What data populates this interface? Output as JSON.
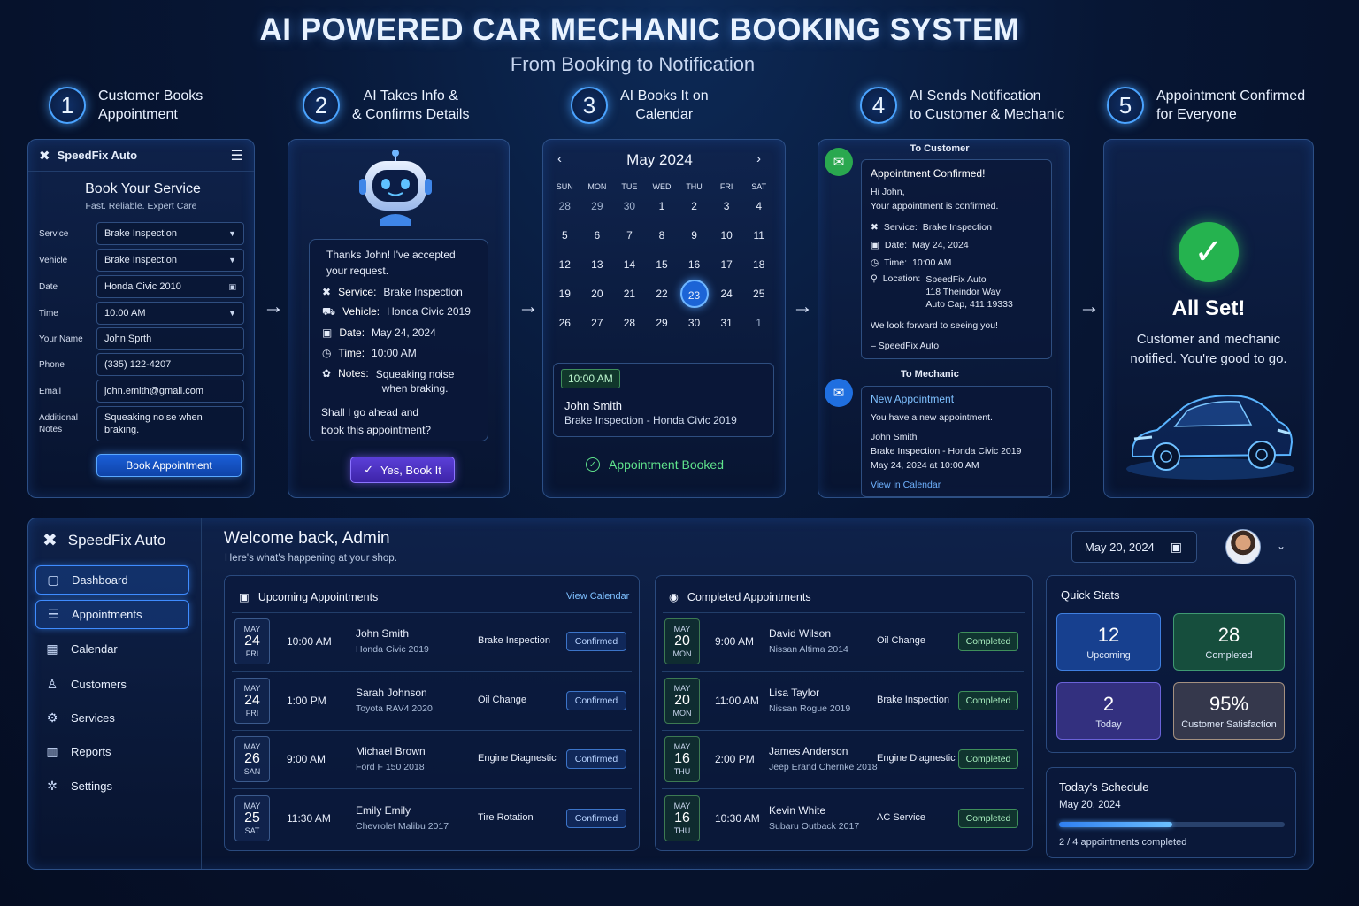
{
  "header": {
    "title": "AI POWERED CAR MECHANIC BOOKING SYSTEM",
    "subtitle": "From Booking to Notification"
  },
  "steps": [
    {
      "num": "1",
      "text": "Customer Books\nAppointment"
    },
    {
      "num": "2",
      "text": "AI Takes Info &\n& Confirms Details"
    },
    {
      "num": "3",
      "text": "AI Books It on\nCalendar"
    },
    {
      "num": "4",
      "text": "AI Sends Notification\nto Customer & Mechanic"
    },
    {
      "num": "5",
      "text": "Appointment Confirmed\nfor Everyone"
    }
  ],
  "arrow": "→",
  "form": {
    "brand": "SpeedFix Auto",
    "title": "Book Your Service",
    "tagline": "Fast. Reliable. Expert Care",
    "fields": [
      {
        "label": "Service",
        "value": "Brake Inspection",
        "kind": "select"
      },
      {
        "label": "Vehicle",
        "value": "Brake Inspection",
        "kind": "select"
      },
      {
        "label": "Date",
        "value": "Honda Civic 2010",
        "kind": "date"
      },
      {
        "label": "Time",
        "value": "10:00 AM",
        "kind": "select"
      },
      {
        "label": "Your Name",
        "value": "John Sprth",
        "kind": "text"
      },
      {
        "label": "Phone",
        "value": "(335) 122-4207",
        "kind": "text"
      },
      {
        "label": "Email",
        "value": "john.emith@gmail.com",
        "kind": "text"
      },
      {
        "label": "Additional\nNotes",
        "value": "Squeaking noise when\nbraking.",
        "kind": "textarea"
      }
    ],
    "submit": "Book Appointment"
  },
  "chat": {
    "intro": "Thanks John! I've accepted\nyour request.",
    "service_label": "Service:",
    "service": "Brake Inspection",
    "vehicle_label": "Vehicle:",
    "vehicle": "Honda Civic 2019",
    "date_label": "Date:",
    "date": "May 24, 2024",
    "time_label": "Time:",
    "time": "10:00 AM",
    "notes_label": "Notes:",
    "notes": "Squeaking noise\nwhen braking.",
    "question": "Shall I go ahead and\nbook this appointment?",
    "confirm_button": "Yes, Book It"
  },
  "calendar": {
    "month": "May 2024",
    "prev": "‹",
    "next": "›",
    "dow": [
      "SUN",
      "MON",
      "TUE",
      "WED",
      "THU",
      "FRI",
      "SAT"
    ],
    "days": [
      "28",
      "29",
      "30",
      "1",
      "2",
      "3",
      "4",
      "5",
      "6",
      "7",
      "8",
      "9",
      "10",
      "11",
      "12",
      "13",
      "14",
      "15",
      "16",
      "17",
      "18",
      "19",
      "20",
      "21",
      "22",
      "23",
      "24",
      "25",
      "26",
      "27",
      "28",
      "29",
      "30",
      "31",
      "1"
    ],
    "muted_days": [
      0,
      1,
      2,
      34
    ],
    "selected_day_index": 25,
    "slot_time": "10:00 AM",
    "slot_name": "John Smith",
    "slot_detail": "Brake Inspection - Honda Civic 2019",
    "status": "Appointment Booked"
  },
  "notify": {
    "customer_heading": "To Customer",
    "c_title": "Appointment Confirmed!",
    "c_greeting": "Hi John,",
    "c_line": "Your appointment is confirmed.",
    "c_service_label": "Service:",
    "c_service": "Brake Inspection",
    "c_date_label": "Date:",
    "c_date": "May 24, 2024",
    "c_time_label": "Time:",
    "c_time": "10:00 AM",
    "c_loc_label": "Location:",
    "c_loc": "SpeedFix Auto\n118 Theindor Way\nAuto Cap, 411 19333",
    "c_closing": "We look forward to seeing you!",
    "c_sign": "– SpeedFix Auto",
    "mechanic_heading": "To Mechanic",
    "m_title": "New Appointment",
    "m_line": "You have a new appointment.",
    "m_name": "John Smith",
    "m_detail": "Brake Inspection - Honda Civic 2019",
    "m_when": "May 24, 2024 at 10:00 AM",
    "m_link": "View in Calendar"
  },
  "done": {
    "title": "All Set!",
    "message": "Customer and mechanic\nnotified. You're good to go."
  },
  "dashboard": {
    "brand": "SpeedFix Auto",
    "nav": [
      {
        "label": "Dashboard",
        "icon": "▢",
        "active": true
      },
      {
        "label": "Appointments",
        "icon": "☰",
        "active": true
      },
      {
        "label": "Calendar",
        "icon": "▦",
        "active": false
      },
      {
        "label": "Customers",
        "icon": "♙",
        "active": false
      },
      {
        "label": "Services",
        "icon": "⚙",
        "active": false
      },
      {
        "label": "Reports",
        "icon": "▥",
        "active": false
      },
      {
        "label": "Settings",
        "icon": "✲",
        "active": false
      }
    ],
    "welcome": "Welcome back, Admin",
    "welcome_sub": "Here's what's happening at your shop.",
    "date": "May 20, 2024",
    "upcoming": {
      "title": "Upcoming Appointments",
      "link": "View Calendar",
      "rows": [
        {
          "month": "MAY",
          "day": "24",
          "wd": "FRI",
          "time": "10:00 AM",
          "name": "John Smith",
          "car": "Honda Civic 2019",
          "service": "Brake Inspection",
          "status": "Confirmed"
        },
        {
          "month": "MAY",
          "day": "24",
          "wd": "FRI",
          "time": "1:00 PM",
          "name": "Sarah Johnson",
          "car": "Toyota RAV4 2020",
          "service": "Oil Change",
          "status": "Confirmed"
        },
        {
          "month": "MAY",
          "day": "26",
          "wd": "SAN",
          "time": "9:00 AM",
          "name": "Michael Brown",
          "car": "Ford F 150 2018",
          "service": "Engine Diagnestic",
          "status": "Confirmed"
        },
        {
          "month": "MAY",
          "day": "25",
          "wd": "SAT",
          "time": "11:30 AM",
          "name": "Emily Emily",
          "car": "Chevrolet Malibu 2017",
          "service": "Tire Rotation",
          "status": "Confirmed"
        }
      ]
    },
    "completed": {
      "title": "Completed Appointments",
      "rows": [
        {
          "month": "MAY",
          "day": "20",
          "wd": "MON",
          "time": "9:00 AM",
          "name": "David Wilson",
          "car": "Nissan Altima 2014",
          "service": "Oil Change",
          "status": "Completed"
        },
        {
          "month": "MAY",
          "day": "20",
          "wd": "MON",
          "time": "11:00 AM",
          "name": "Lisa Taylor",
          "car": "Nissan Rogue 2019",
          "service": "Brake Inspection",
          "status": "Completed"
        },
        {
          "month": "MAY",
          "day": "16",
          "wd": "THU",
          "time": "2:00 PM",
          "name": "James Anderson",
          "car": "Jeep Erand Chernke 2018",
          "service": "Engine Diagnestic",
          "status": "Completed"
        },
        {
          "month": "MAY",
          "day": "16",
          "wd": "THU",
          "time": "10:30 AM",
          "name": "Kevin White",
          "car": "Subaru Outback 2017",
          "service": "AC Service",
          "status": "Completed"
        }
      ]
    },
    "quick_stats": {
      "title": "Quick Stats",
      "items": [
        {
          "value": "12",
          "label": "Upcoming",
          "color": "#1a4aa8"
        },
        {
          "value": "28",
          "label": "Completed",
          "color": "#1b5a45"
        },
        {
          "value": "2",
          "label": "Today",
          "color": "#3a3590"
        },
        {
          "value": "95%",
          "label": "Customer Satisfaction",
          "color": "#3a3f55"
        }
      ]
    },
    "schedule": {
      "title": "Today's Schedule",
      "date": "May 20, 2024",
      "progress": 0.5,
      "progress_text": "2 / 4 appointments completed"
    }
  }
}
